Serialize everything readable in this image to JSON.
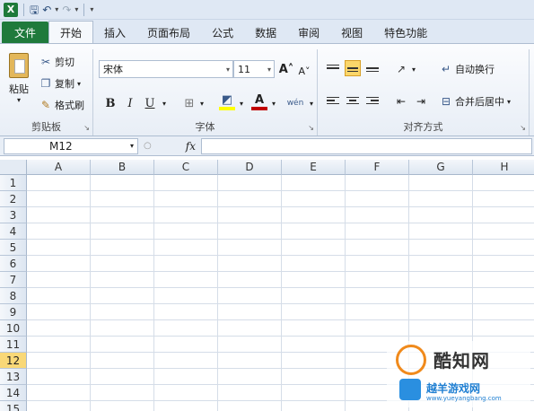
{
  "app": {
    "logo": "X"
  },
  "quick_access": [
    "save-icon",
    "undo-icon",
    "redo-icon",
    "customize-icon"
  ],
  "tabs": [
    {
      "label": "文件",
      "active": false
    },
    {
      "label": "开始",
      "active": true
    },
    {
      "label": "插入",
      "active": false
    },
    {
      "label": "页面布局",
      "active": false
    },
    {
      "label": "公式",
      "active": false
    },
    {
      "label": "数据",
      "active": false
    },
    {
      "label": "审阅",
      "active": false
    },
    {
      "label": "视图",
      "active": false
    },
    {
      "label": "特色功能",
      "active": false
    }
  ],
  "clipboard": {
    "paste": "粘贴",
    "cut": "剪切",
    "copy": "复制",
    "format_painter": "格式刷",
    "group": "剪贴板"
  },
  "font": {
    "name": "宋体",
    "size": "11",
    "bold": "B",
    "italic": "I",
    "underline": "U",
    "group": "字体",
    "font_color": "#c00000",
    "fill_color": "#ffff00"
  },
  "alignment": {
    "wrap": "自动换行",
    "merge": "合并后居中",
    "group": "对齐方式"
  },
  "formula_bar": {
    "name_box": "M12",
    "fx": "fx",
    "value": ""
  },
  "columns": [
    "A",
    "B",
    "C",
    "D",
    "E",
    "F",
    "G",
    "H"
  ],
  "rows": [
    "1",
    "2",
    "3",
    "4",
    "5",
    "6",
    "7",
    "8",
    "9",
    "10",
    "11",
    "12",
    "13",
    "14",
    "15"
  ],
  "selected_row": "12",
  "watermark": {
    "title": "酷知网",
    "subtitle": "越羊游戏网",
    "url": "www.yueyangbang.com"
  }
}
